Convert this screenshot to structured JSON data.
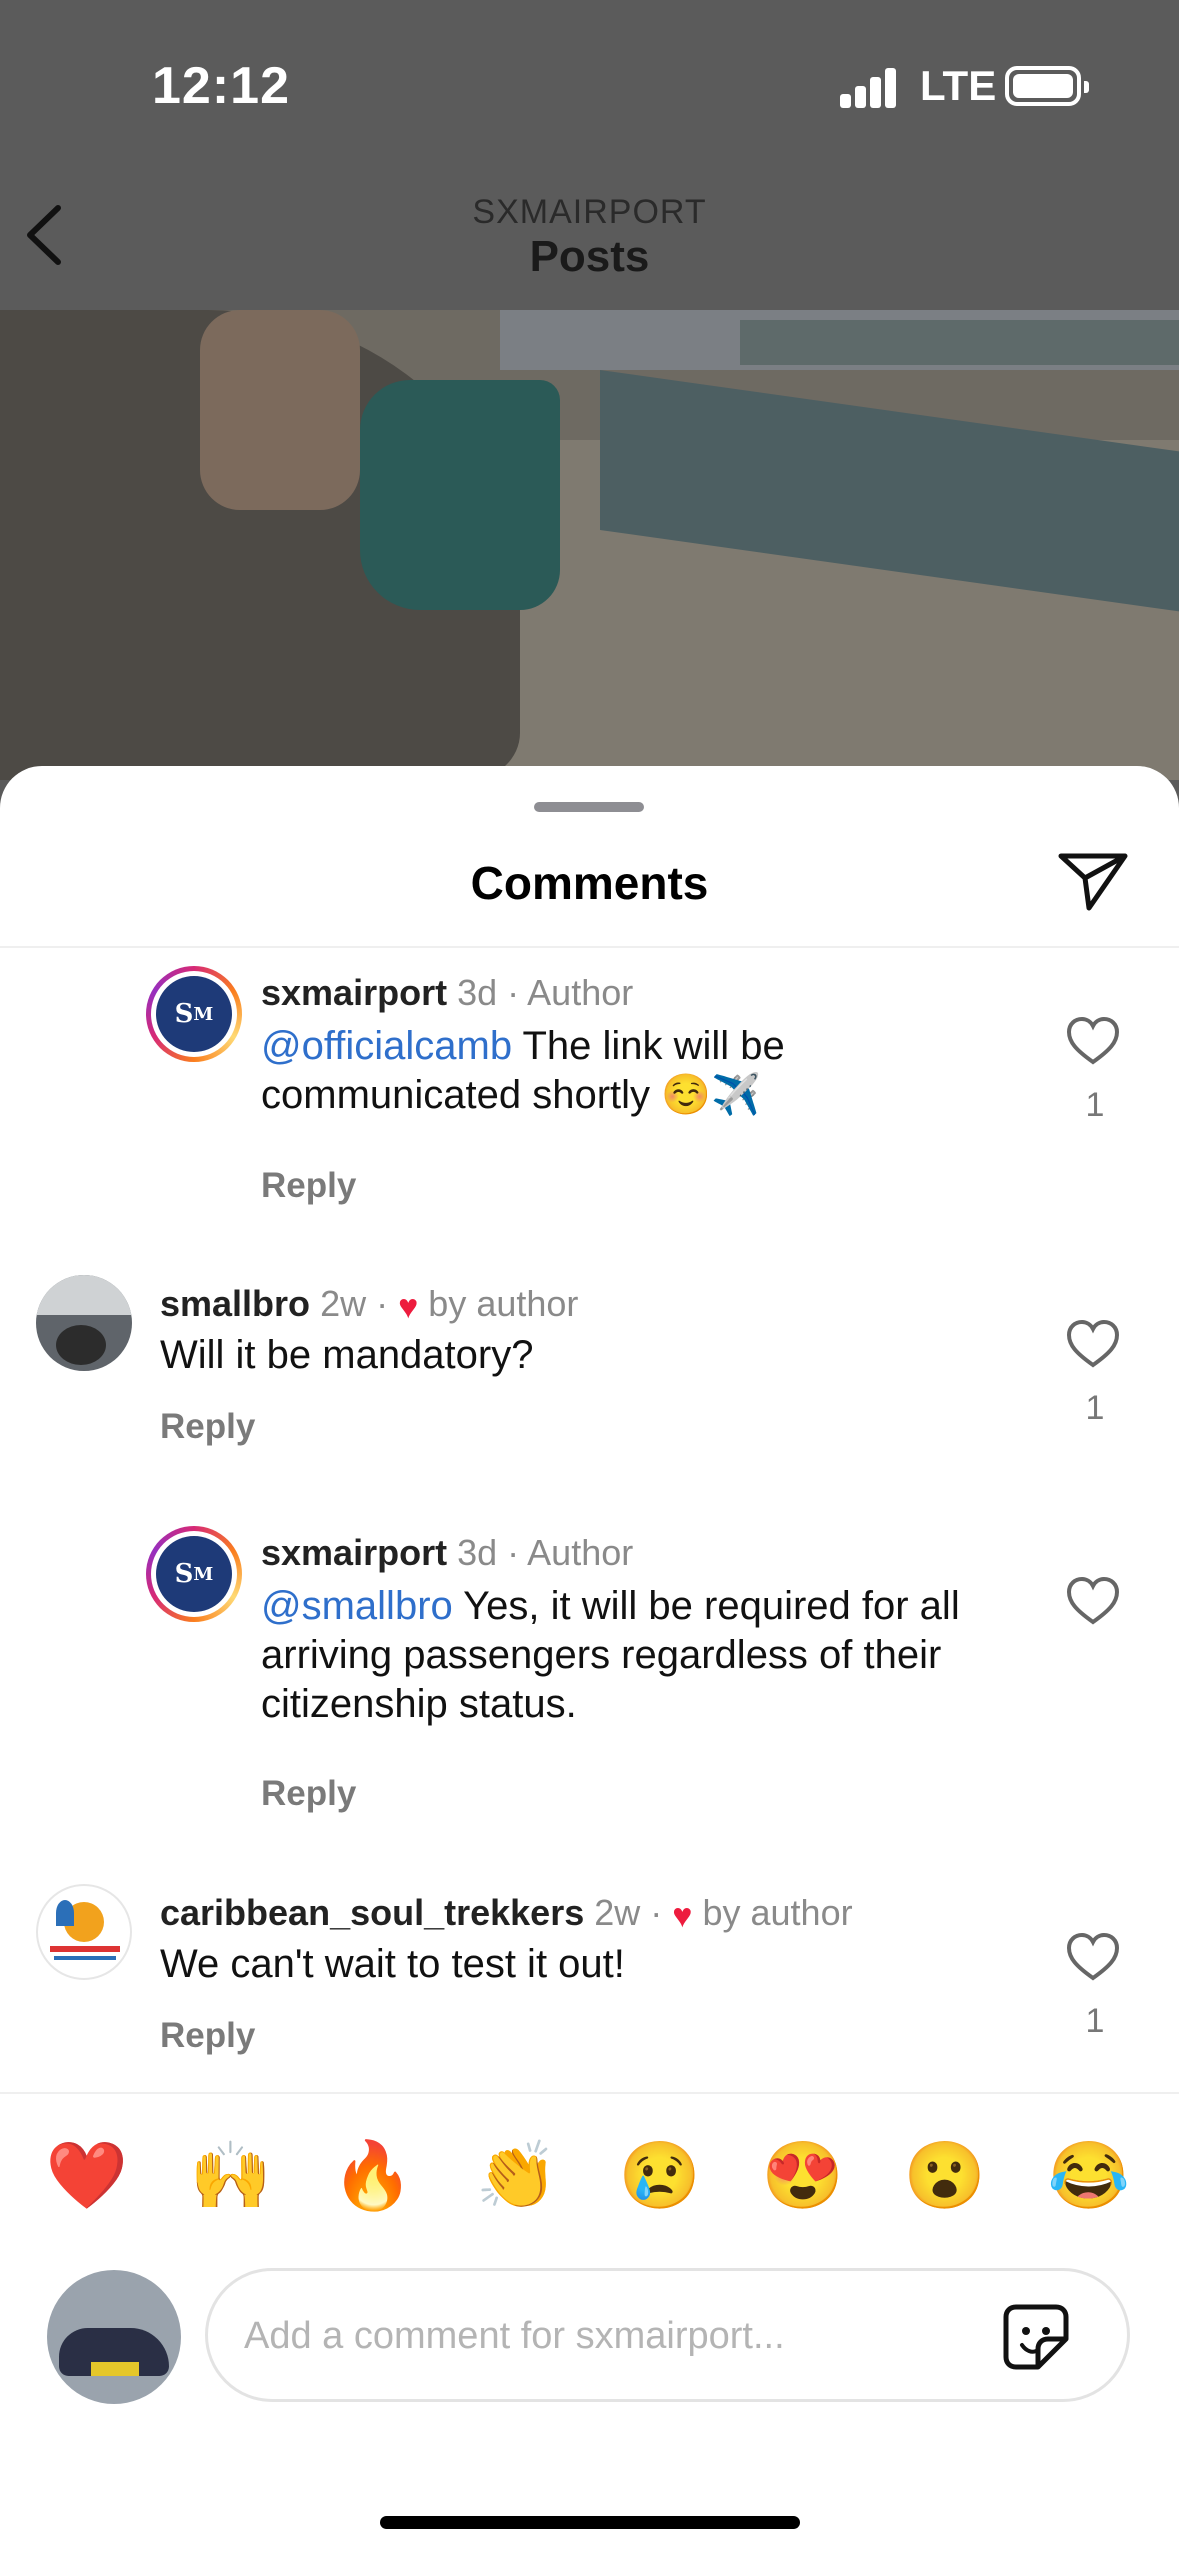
{
  "status_bar": {
    "time": "12:12",
    "network": "LTE"
  },
  "nav": {
    "account": "SXMAIRPORT",
    "title": "Posts"
  },
  "sheet": {
    "title": "Comments"
  },
  "comments": [
    {
      "username": "sxmairport",
      "age": "3d",
      "tag": "Author",
      "mention": "@officialcamb",
      "text": "The link will be communicated shortly ☺️✈️",
      "reply_label": "Reply",
      "likes": "1"
    },
    {
      "username": "smallbro",
      "age": "2w",
      "tag": "by author",
      "text": "Will it be mandatory?",
      "reply_label": "Reply",
      "likes": "1"
    },
    {
      "username": "sxmairport",
      "age": "3d",
      "tag": "Author",
      "mention": "@smallbro",
      "text": "Yes, it will be required for all arriving passengers regardless of their citizenship status.",
      "reply_label": "Reply",
      "likes": ""
    },
    {
      "username": "caribbean_soul_trekkers",
      "age": "2w",
      "tag": "by author",
      "text": "We can't wait to test it out!",
      "reply_label": "Reply",
      "likes": "1"
    }
  ],
  "emoji_bar": [
    "❤️",
    "🙌",
    "🔥",
    "👏",
    "😢",
    "😍",
    "😮",
    "😂"
  ],
  "composer": {
    "placeholder": "Add a comment for sxmairport..."
  },
  "colors": {
    "mention": "#2f6fcb",
    "like_heart": "#ed1c3e"
  }
}
